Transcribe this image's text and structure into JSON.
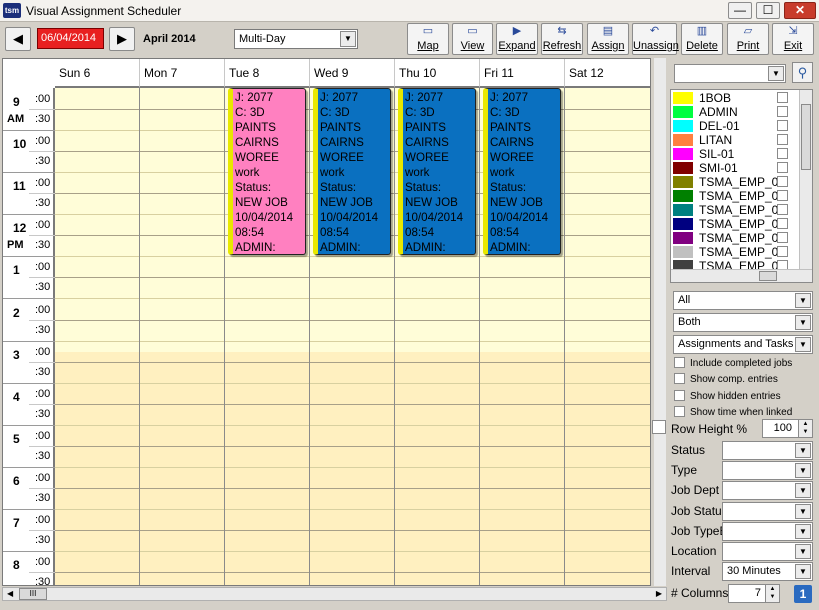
{
  "window": {
    "title": "Visual Assignment Scheduler",
    "icon_label": "tsm",
    "min": "—",
    "max": "☐",
    "close": "✕"
  },
  "nav": {
    "prev": "◀",
    "next": "▶",
    "date": "06/04/2014",
    "month": "April 2014",
    "view_mode": "Multi-Day"
  },
  "toolbar": [
    {
      "label": "Map",
      "icon": "map-icon",
      "glyph": "▭"
    },
    {
      "label": "View",
      "icon": "view-icon",
      "glyph": "▭"
    },
    {
      "label": "Expand",
      "icon": "expand-icon",
      "glyph": "▶"
    },
    {
      "label": "Refresh",
      "icon": "refresh-icon",
      "glyph": "⇆"
    },
    {
      "label": "Assign",
      "icon": "assign-icon",
      "glyph": "▤"
    },
    {
      "label": "Unassign",
      "icon": "unassign-icon",
      "glyph": "↶"
    },
    {
      "label": "Delete",
      "icon": "delete-icon",
      "glyph": "▥"
    },
    {
      "label": "Print",
      "icon": "print-icon",
      "glyph": "▱"
    },
    {
      "label": "Exit",
      "icon": "exit-icon",
      "glyph": "⇲"
    }
  ],
  "days": [
    "Sun 6",
    "Mon 7",
    "Tue 8",
    "Wed 9",
    "Thu 10",
    "Fri 11",
    "Sat 12"
  ],
  "time_rows": [
    {
      "hour": "9",
      "period": "AM"
    },
    {
      "hour": "10",
      "period": ""
    },
    {
      "hour": "11",
      "period": ""
    },
    {
      "hour": "12",
      "period": "PM"
    },
    {
      "hour": "1",
      "period": ""
    },
    {
      "hour": "2",
      "period": ""
    },
    {
      "hour": "3",
      "period": ""
    },
    {
      "hour": "4",
      "period": ""
    },
    {
      "hour": "5",
      "period": ""
    },
    {
      "hour": "6",
      "period": ""
    },
    {
      "hour": "7",
      "period": ""
    },
    {
      "hour": "8",
      "period": ""
    }
  ],
  "minute_labels": [
    ":00",
    ":30"
  ],
  "appointments": [
    {
      "day": 2,
      "color": "#ff80c0",
      "lines": [
        "J: 2077",
        "C: 3D",
        "PAINTS",
        "CAIRNS",
        "WOREE",
        "work",
        "Status:",
        "NEW JOB",
        "10/04/2014",
        "08:54",
        "ADMIN:"
      ]
    },
    {
      "day": 3,
      "color": "#0a70c0",
      "lines": [
        "J: 2077",
        "C: 3D",
        "PAINTS",
        "CAIRNS",
        "WOREE",
        "work",
        "Status:",
        "NEW JOB",
        "10/04/2014",
        "08:54",
        "ADMIN:"
      ]
    },
    {
      "day": 4,
      "color": "#0a70c0",
      "lines": [
        "J: 2077",
        "C: 3D",
        "PAINTS",
        "CAIRNS",
        "WOREE",
        "work",
        "Status:",
        "NEW JOB",
        "10/04/2014",
        "08:54",
        "ADMIN:"
      ]
    },
    {
      "day": 5,
      "color": "#0a70c0",
      "lines": [
        "J: 2077",
        "C: 3D",
        "PAINTS",
        "CAIRNS",
        "WOREE",
        "work",
        "Status:",
        "NEW JOB",
        "10/04/2014",
        "08:54",
        "ADMIN:"
      ]
    }
  ],
  "colors": {
    "slot_light": "#fffdd8",
    "slot_dark": "#fff0c0",
    "accent_red": "#e82020"
  },
  "legend": [
    {
      "name": "1BOB",
      "color": "#ffff00"
    },
    {
      "name": "ADMIN",
      "color": "#00ff40"
    },
    {
      "name": "DEL-01",
      "color": "#00ffff"
    },
    {
      "name": "LITAN",
      "color": "#ff8040"
    },
    {
      "name": "SIL-01",
      "color": "#ff00ff"
    },
    {
      "name": "SMI-01",
      "color": "#800000"
    },
    {
      "name": "TSMA_EMP_0",
      "color": "#808000"
    },
    {
      "name": "TSMA_EMP_0",
      "color": "#008000"
    },
    {
      "name": "TSMA_EMP_0",
      "color": "#008080"
    },
    {
      "name": "TSMA_EMP_0",
      "color": "#000080"
    },
    {
      "name": "TSMA_EMP_0",
      "color": "#800080"
    },
    {
      "name": "TSMA_EMP_0",
      "color": "#c0c0c0"
    },
    {
      "name": "TSMA_EMP_0",
      "color": "#404040"
    }
  ],
  "filters": {
    "scope": "All",
    "mode": "Both",
    "type": "Assignments and Tasks"
  },
  "checkboxes": [
    "Include completed jobs",
    "Show comp. entries",
    "Show hidden entries",
    "Show time when linked"
  ],
  "row_height": {
    "label": "Row Height %",
    "value": "100"
  },
  "fields": [
    {
      "label": "Status",
      "value": ""
    },
    {
      "label": "Type",
      "value": ""
    },
    {
      "label": "Job Dept",
      "value": ""
    },
    {
      "label": "Job Status",
      "value": ""
    },
    {
      "label": "Job TypeE",
      "value": ""
    },
    {
      "label": "Location",
      "value": ""
    },
    {
      "label": "Interval",
      "value": "30 Minutes"
    }
  ],
  "columns": {
    "label": "# Columns",
    "value": "7"
  }
}
